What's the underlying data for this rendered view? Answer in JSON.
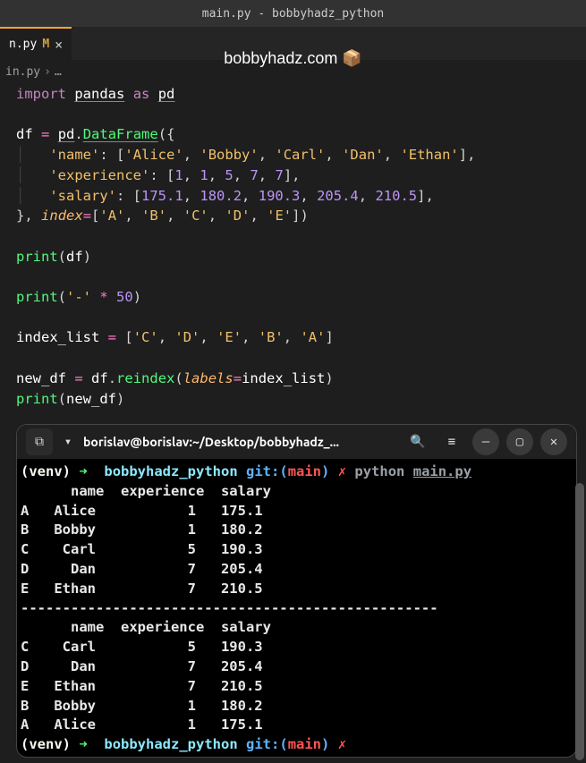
{
  "window": {
    "title": "main.py - bobbyhadz_python"
  },
  "tab": {
    "label": "n.py",
    "modified": "M",
    "close": "×"
  },
  "watermark": "bobbyhadz.com 📦",
  "breadcrumb": {
    "file": "in.py",
    "sep": "›",
    "ell": "…"
  },
  "code": {
    "import": "import",
    "pandas": "pandas",
    "as": "as",
    "pd": "pd",
    "df": "df",
    "eq": "=",
    "dot": ".",
    "DataFrame": "DataFrame",
    "lp": "(",
    "rp": ")",
    "lb": "[",
    "rb": "]",
    "lc": "{",
    "rc": "}",
    "c": ",",
    "col": ":",
    "k_name": "'name'",
    "k_exp": "'experience'",
    "k_sal": "'salary'",
    "alice": "'Alice'",
    "bobby": "'Bobby'",
    "carl": "'Carl'",
    "dan": "'Dan'",
    "ethan": "'Ethan'",
    "n1": "1",
    "n5": "5",
    "n7": "7",
    "s1": "175.1",
    "s2": "180.2",
    "s3": "190.3",
    "s4": "205.4",
    "s5": "210.5",
    "index": "index",
    "A": "'A'",
    "B": "'B'",
    "C": "'C'",
    "D": "'D'",
    "E": "'E'",
    "print": "print",
    "dash": "'-'",
    "star": "*",
    "n50": "50",
    "index_list": "index_list",
    "new_df": "new_df",
    "reindex": "reindex",
    "labels": "labels"
  },
  "terminal": {
    "newtab": "⧉",
    "drop": "▾",
    "title": "borislav@borislav:~/Desktop/bobbyhadz_...",
    "icons": {
      "search": "🔍",
      "menu": "≡",
      "min": "–",
      "max": "▢",
      "close": "✕"
    },
    "venv": "(venv)",
    "arrow": "➜",
    "dir": "bobbyhadz_python",
    "git": "git:(",
    "branch": "main",
    "gitend": ")",
    "x": "✗",
    "python": "python",
    "script": "main.py",
    "hdr": "      name  experience  salary",
    "r1": "A   Alice           1   175.1",
    "r2": "B   Bobby           1   180.2",
    "r3": "C    Carl           5   190.3",
    "r4": "D     Dan           7   205.4",
    "r5": "E   Ethan           7   210.5",
    "sep": "--------------------------------------------------",
    "o1": "C    Carl           5   190.3",
    "o2": "D     Dan           7   205.4",
    "o3": "E   Ethan           7   210.5",
    "o4": "B   Bobby           1   180.2",
    "o5": "A   Alice           1   175.1"
  }
}
